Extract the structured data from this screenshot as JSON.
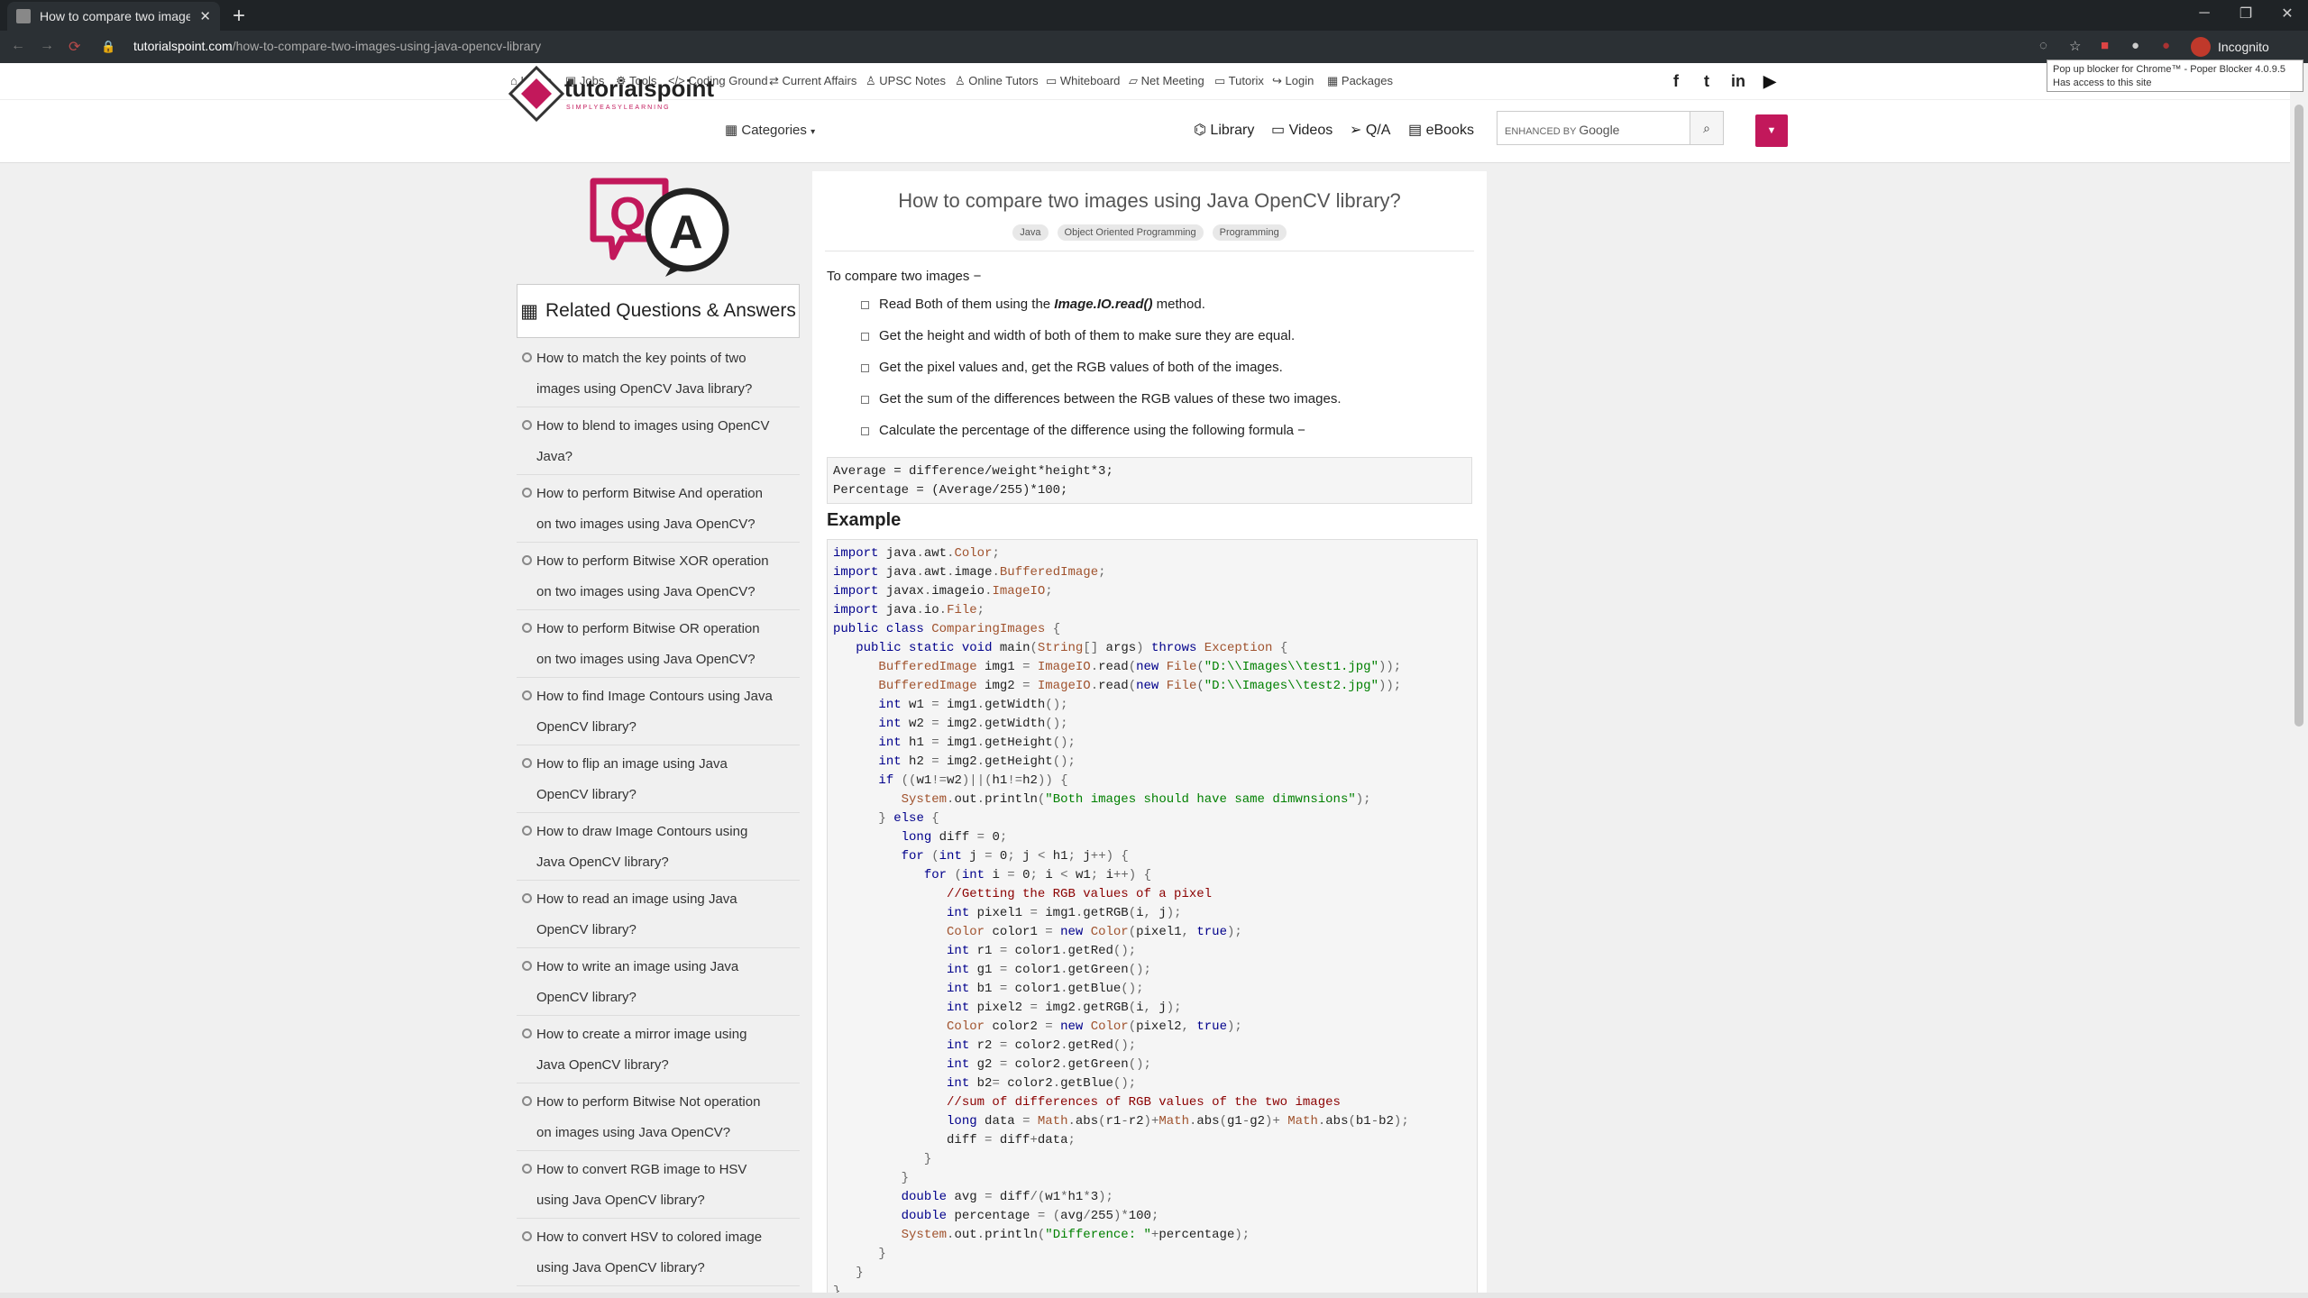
{
  "browser": {
    "tab_title": "How to compare two images us",
    "url_host": "tutorialspoint.com",
    "url_path": "/how-to-compare-two-images-using-java-opencv-library",
    "incognito_label": "Incognito",
    "tooltip_line1": "Pop up blocker for Chrome™ - Poper Blocker 4.0.9.5",
    "tooltip_line2": "Has access to this site"
  },
  "topnav": {
    "links": [
      "Home",
      "Jobs",
      "Tools",
      "Coding Ground",
      "Current Affairs",
      "UPSC Notes",
      "Online Tutors",
      "Whiteboard",
      "Net Meeting",
      "Tutorix",
      "Login",
      "Packages"
    ],
    "social": [
      "f",
      "t",
      "in",
      "▶"
    ]
  },
  "mainnav": {
    "logo_text": "tutorialspoint",
    "logo_tagline": "SIMPLYEASYLEARNING",
    "categories": "Categories",
    "library": "Library",
    "videos": "Videos",
    "qa": "Q/A",
    "ebooks": "eBooks",
    "search_prefix": "ENHANCED BY",
    "search_brand": "Google"
  },
  "sidebar": {
    "heading": "Related Questions & Answers",
    "items": [
      {
        "l1": "How to match the key points of two",
        "l2": "images using OpenCV Java library?"
      },
      {
        "l1": "How to blend to images using OpenCV",
        "l2": "Java?"
      },
      {
        "l1": "How to perform Bitwise And operation",
        "l2": "on two images using Java OpenCV?"
      },
      {
        "l1": "How to perform Bitwise XOR operation",
        "l2": "on two images using Java OpenCV?"
      },
      {
        "l1": "How to perform Bitwise OR operation",
        "l2": "on two images using Java OpenCV?"
      },
      {
        "l1": "How to find Image Contours using Java",
        "l2": "OpenCV library?"
      },
      {
        "l1": "How to flip an image using Java",
        "l2": "OpenCV library?"
      },
      {
        "l1": "How to draw Image Contours using",
        "l2": "Java OpenCV library?"
      },
      {
        "l1": "How to read an image using Java",
        "l2": "OpenCV library?"
      },
      {
        "l1": "How to write an image using Java",
        "l2": "OpenCV library?"
      },
      {
        "l1": "How to create a mirror image using",
        "l2": "Java OpenCV library?"
      },
      {
        "l1": "How to perform Bitwise Not operation",
        "l2": "on images using Java OpenCV?"
      },
      {
        "l1": "How to convert RGB image to HSV",
        "l2": "using Java OpenCV library?"
      },
      {
        "l1": "How to convert HSV to colored image",
        "l2": "using Java OpenCV library?"
      }
    ]
  },
  "article": {
    "title": "How to compare two images using Java OpenCV library?",
    "tags": [
      "Java",
      "Object Oriented Programming",
      "Programming"
    ],
    "intro": "To compare two images −",
    "steps": [
      {
        "before": "Read Both of them using the ",
        "em": "Image.IO.read()",
        "after": " method."
      },
      {
        "before": "Get the height and width of both of them to make sure they are equal.",
        "em": "",
        "after": ""
      },
      {
        "before": "Get the pixel values and, get the RGB values of both of the images.",
        "em": "",
        "after": ""
      },
      {
        "before": "Get the sum of the differences between the RGB values of these two images.",
        "em": "",
        "after": ""
      },
      {
        "before": "Calculate the percentage of the difference using the following formula −",
        "em": "",
        "after": ""
      }
    ],
    "formula": [
      "Average = difference/weight*height*3;",
      "Percentage = (Average/255)*100;"
    ],
    "example_heading": "Example",
    "code": [
      "import java.awt.Color;",
      "import java.awt.image.BufferedImage;",
      "import javax.imageio.ImageIO;",
      "import java.io.File;",
      "public class ComparingImages {",
      "   public static void main(String[] args) throws Exception {",
      "      BufferedImage img1 = ImageIO.read(new File(\"D:\\\\Images\\\\test1.jpg\"));",
      "      BufferedImage img2 = ImageIO.read(new File(\"D:\\\\Images\\\\test2.jpg\"));",
      "      int w1 = img1.getWidth();",
      "      int w2 = img2.getWidth();",
      "      int h1 = img1.getHeight();",
      "      int h2 = img2.getHeight();",
      "      if ((w1!=w2)||(h1!=h2)) {",
      "         System.out.println(\"Both images should have same dimwnsions\");",
      "      } else {",
      "         long diff = 0;",
      "         for (int j = 0; j < h1; j++) {",
      "            for (int i = 0; i < w1; i++) {",
      "               //Getting the RGB values of a pixel",
      "               int pixel1 = img1.getRGB(i, j);",
      "               Color color1 = new Color(pixel1, true);",
      "               int r1 = color1.getRed();",
      "               int g1 = color1.getGreen();",
      "               int b1 = color1.getBlue();",
      "               int pixel2 = img2.getRGB(i, j);",
      "               Color color2 = new Color(pixel2, true);",
      "               int r2 = color2.getRed();",
      "               int g2 = color2.getGreen();",
      "               int b2= color2.getBlue();",
      "               //sum of differences of RGB values of the two images",
      "               long data = Math.abs(r1-r2)+Math.abs(g1-g2)+ Math.abs(b1-b2);",
      "               diff = diff+data;",
      "            }",
      "         }",
      "         double avg = diff/(w1*h1*3);",
      "         double percentage = (avg/255)*100;",
      "         System.out.println(\"Difference: \"+percentage);",
      "      }",
      "   }",
      "}"
    ]
  },
  "colors": {
    "brand": "#c2185b",
    "accent_red": "#c0392b"
  }
}
